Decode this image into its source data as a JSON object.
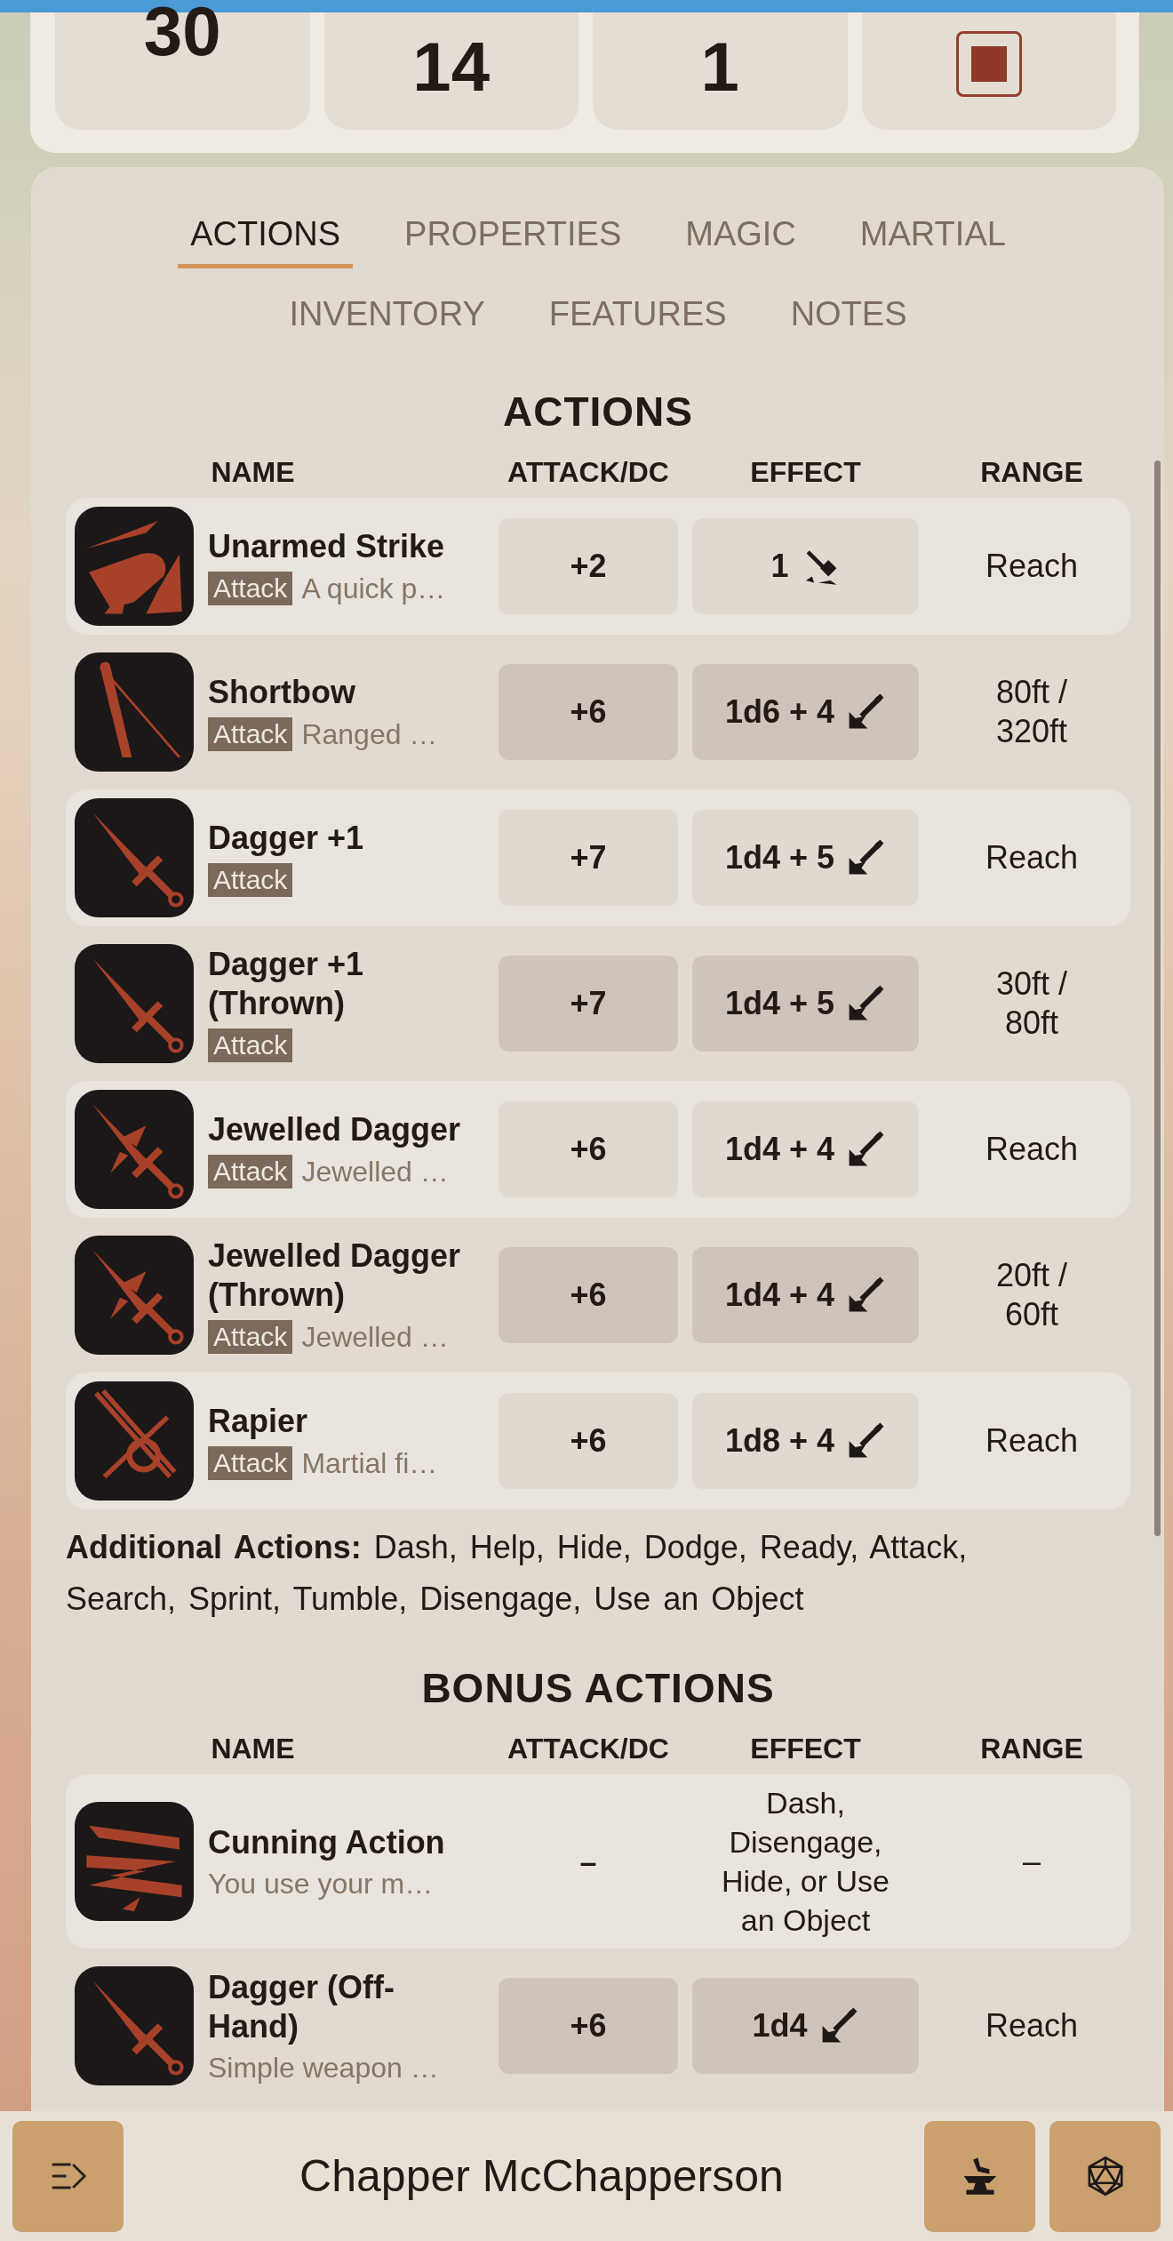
{
  "stats": [
    {
      "kind": "number",
      "value": "30"
    },
    {
      "kind": "number",
      "value": "14"
    },
    {
      "kind": "number",
      "value": "1"
    },
    {
      "kind": "checkbox",
      "checked": true
    }
  ],
  "tabs": [
    {
      "label": "ACTIONS",
      "selected": true
    },
    {
      "label": "PROPERTIES",
      "selected": false
    },
    {
      "label": "MAGIC",
      "selected": false
    },
    {
      "label": "MARTIAL",
      "selected": false
    },
    {
      "label": "INVENTORY",
      "selected": false
    },
    {
      "label": "FEATURES",
      "selected": false
    },
    {
      "label": "NOTES",
      "selected": false
    }
  ],
  "sections": [
    {
      "title": "ACTIONS",
      "columns": [
        "NAME",
        "ATTACK/DC",
        "EFFECT",
        "RANGE"
      ],
      "rows": [
        {
          "kind": "weapon",
          "name": "Unarmed Strike",
          "tag": "Attack",
          "description": "A quick p…",
          "attack": "+2",
          "effect": {
            "kind": "bludgeoning",
            "text": "1"
          },
          "range": "Reach"
        },
        {
          "kind": "weapon",
          "name": "Shortbow",
          "tag": "Attack",
          "description": "Ranged …",
          "attack": "+6",
          "effect": {
            "kind": "piercing",
            "text": "1d6 + 4"
          },
          "range": "80ft / 320ft"
        },
        {
          "kind": "weapon",
          "name": "Dagger +1",
          "tag": "Attack",
          "attack": "+7",
          "effect": {
            "kind": "piercing",
            "text": "1d4 + 5"
          },
          "range": "Reach"
        },
        {
          "kind": "weapon",
          "name": "Dagger +1 (Thrown)",
          "tag": "Attack",
          "attack": "+7",
          "effect": {
            "kind": "piercing",
            "text": "1d4 + 5"
          },
          "range": "30ft / 80ft"
        },
        {
          "kind": "weapon",
          "name": "Jewelled Dagger",
          "tag": "Attack",
          "description": "Jewelled …",
          "attack": "+6",
          "effect": {
            "kind": "piercing",
            "text": "1d4 + 4"
          },
          "range": "Reach"
        },
        {
          "kind": "weapon",
          "name": "Jewelled Dagger (Thrown)",
          "tag": "Attack",
          "description": "Jewelled …",
          "attack": "+6",
          "effect": {
            "kind": "piercing",
            "text": "1d4 + 4"
          },
          "range": "20ft / 60ft"
        },
        {
          "kind": "weapon",
          "name": "Rapier",
          "tag": "Attack",
          "description": "Martial fi…",
          "attack": "+6",
          "effect": {
            "kind": "piercing",
            "text": "1d8 + 4"
          },
          "range": "Reach"
        }
      ],
      "additional": "**Additional Actions:**  Dash, Help, Hide, Dodge, Ready, Attack, Search, Sprint, Tumble, Disengage, Use an Object"
    },
    {
      "title": "BONUS ACTIONS",
      "columns": [
        "NAME",
        "ATTACK/DC",
        "EFFECT",
        "RANGE"
      ],
      "rows": [
        {
          "kind": "feature",
          "name": "Cunning Action",
          "description": "You use your m…",
          "attack": "–",
          "effect": {
            "kind": "text",
            "text": "Dash, Disengage, Hide, or Use an Object"
          },
          "range": "–"
        },
        {
          "kind": "weapon",
          "name": "Dagger (Off-Hand)",
          "description": "Simple weapon …",
          "attack": "+6",
          "effect": {
            "kind": "piercing",
            "text": "1d4"
          },
          "range": "Reach"
        }
      ]
    }
  ],
  "footer": {
    "title": "Chapper McChapperson"
  }
}
